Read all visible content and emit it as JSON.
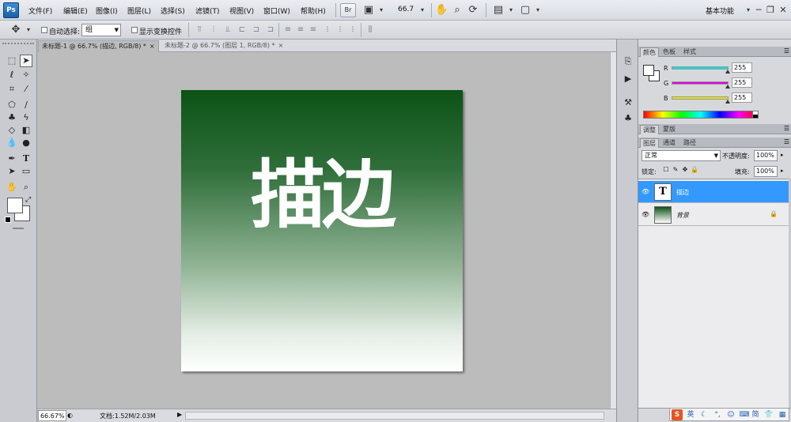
{
  "app": {
    "logo": "Ps",
    "workspace": "基本功能",
    "zoom_menu_value": "66.7",
    "bridge_label": "Br"
  },
  "menu": [
    "文件(F)",
    "编辑(E)",
    "图像(I)",
    "图层(L)",
    "选择(S)",
    "滤镜(T)",
    "视图(V)",
    "窗口(W)",
    "帮助(H)"
  ],
  "window_buttons": {
    "minimize": "─",
    "restore": "❐",
    "close": "✕"
  },
  "options_bar": {
    "auto_select_label": "自动选择:",
    "auto_select_value": "组",
    "show_transform_label": "显示变换控件"
  },
  "tabs": [
    {
      "label": "未标题-1 @ 66.7% (描边, RGB/8) *",
      "close": "×"
    },
    {
      "label": "未标题-2 @ 66.7% (图层 1, RGB/8) *",
      "close": "×"
    }
  ],
  "canvas": {
    "text": "描边",
    "gradient_top": "#0c5316",
    "gradient_bottom": "#ffffff"
  },
  "status": {
    "zoom": "66.67%",
    "doc_info": "文档:1.52M/2.03M",
    "arrow": "▶"
  },
  "color_panel": {
    "tabs": [
      "颜色",
      "色板",
      "样式"
    ],
    "channels": [
      {
        "label": "R",
        "value": "255",
        "color": "#00e5e5"
      },
      {
        "label": "G",
        "value": "255",
        "color": "#e500e5"
      },
      {
        "label": "B",
        "value": "255",
        "color": "#e5e500"
      }
    ]
  },
  "adjust_panel": {
    "tabs": [
      "调整",
      "蒙版"
    ]
  },
  "layers_panel": {
    "tabs": [
      "图层",
      "通道",
      "路径"
    ],
    "blend_mode": "正常",
    "opacity_label": "不透明度:",
    "opacity": "100%",
    "lock_label": "锁定:",
    "fill_label": "填充:",
    "fill": "100%",
    "layers": [
      {
        "name": "描边",
        "thumb": "T",
        "selected": true
      },
      {
        "name": "背景",
        "thumb": "",
        "selected": false
      }
    ]
  },
  "ime": {
    "logo": "S",
    "lang": "英",
    "simplified": "简"
  },
  "colors": {
    "selection": "#3399ff",
    "chrome": "#d6d8dc",
    "canvas_bg": "#bcbcbc"
  }
}
